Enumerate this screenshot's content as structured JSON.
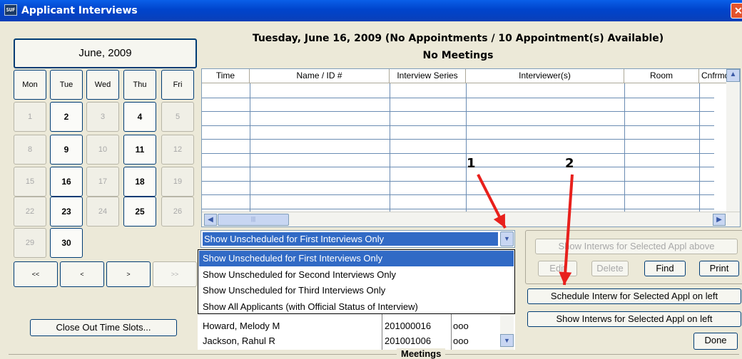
{
  "window": {
    "title": "Applicant Interviews",
    "icon": "app-icon",
    "icon_text": "SUF"
  },
  "calendar": {
    "month_label": "June, 2009",
    "day_headers": [
      "Mon",
      "Tue",
      "Wed",
      "Thu",
      "Fri"
    ],
    "weeks": [
      [
        {
          "d": "1",
          "s": "disabled"
        },
        {
          "d": "2",
          "s": "active"
        },
        {
          "d": "3",
          "s": "disabled"
        },
        {
          "d": "4",
          "s": "active"
        },
        {
          "d": "5",
          "s": "disabled"
        }
      ],
      [
        {
          "d": "8",
          "s": "disabled"
        },
        {
          "d": "9",
          "s": "active"
        },
        {
          "d": "10",
          "s": "disabled"
        },
        {
          "d": "11",
          "s": "active"
        },
        {
          "d": "12",
          "s": "disabled"
        }
      ],
      [
        {
          "d": "15",
          "s": "disabled"
        },
        {
          "d": "16",
          "s": "today"
        },
        {
          "d": "17",
          "s": "disabled"
        },
        {
          "d": "18",
          "s": "active"
        },
        {
          "d": "19",
          "s": "disabled"
        }
      ],
      [
        {
          "d": "22",
          "s": "disabled"
        },
        {
          "d": "23",
          "s": "active"
        },
        {
          "d": "24",
          "s": "disabled"
        },
        {
          "d": "25",
          "s": "active"
        },
        {
          "d": "26",
          "s": "disabled"
        }
      ],
      [
        {
          "d": "29",
          "s": "disabled"
        },
        {
          "d": "30",
          "s": "active"
        }
      ]
    ],
    "nav": [
      {
        "label": "<<",
        "name": "prev-year-button",
        "enabled": true
      },
      {
        "label": "<",
        "name": "prev-month-button",
        "enabled": true
      },
      {
        "label": ">",
        "name": "next-month-button",
        "enabled": true
      },
      {
        "label": ">>",
        "name": "next-year-button",
        "enabled": false
      }
    ],
    "close_out_label": "Close Out Time Slots..."
  },
  "schedule": {
    "date_header": "Tuesday, June 16, 2009 (No Appointments / 10 Appointment(s) Available)",
    "meetings_header": "No Meetings",
    "columns": [
      "Time",
      "Name / ID #",
      "Interview Series",
      "Interviewer(s)",
      "Room",
      "Cnfrmd"
    ],
    "row_count": 9
  },
  "filter": {
    "selected": "Show Unscheduled for First Interviews Only",
    "options": [
      "Show Unscheduled for First Interviews Only",
      "Show Unscheduled for Second Interviews Only",
      "Show Unscheduled for Third Interviews Only",
      "Show All Applicants (with Official Status of Interview)"
    ]
  },
  "applicants": [
    {
      "name": "Howard, Melody M",
      "id": "201000016",
      "code": "ooo"
    },
    {
      "name": "Jackson, Rahul R",
      "id": "201001006",
      "code": "ooo"
    }
  ],
  "actions": {
    "show_interviews_above": "Show Interws for Selected Appl above",
    "edit": "Edit",
    "delete": "Delete",
    "find": "Find",
    "print": "Print",
    "schedule_left": "Schedule Interw for Selected Appl on left",
    "show_interviews_left": "Show Interws for Selected Appl on left",
    "done": "Done"
  },
  "footer": {
    "meetings_label": "Meetings"
  },
  "annotations": [
    "1",
    "2"
  ],
  "colors": {
    "title_bar": "#0a5fe8",
    "selection": "#316ac5",
    "arrow": "#e8201c",
    "window_bg": "#ece9d8"
  }
}
